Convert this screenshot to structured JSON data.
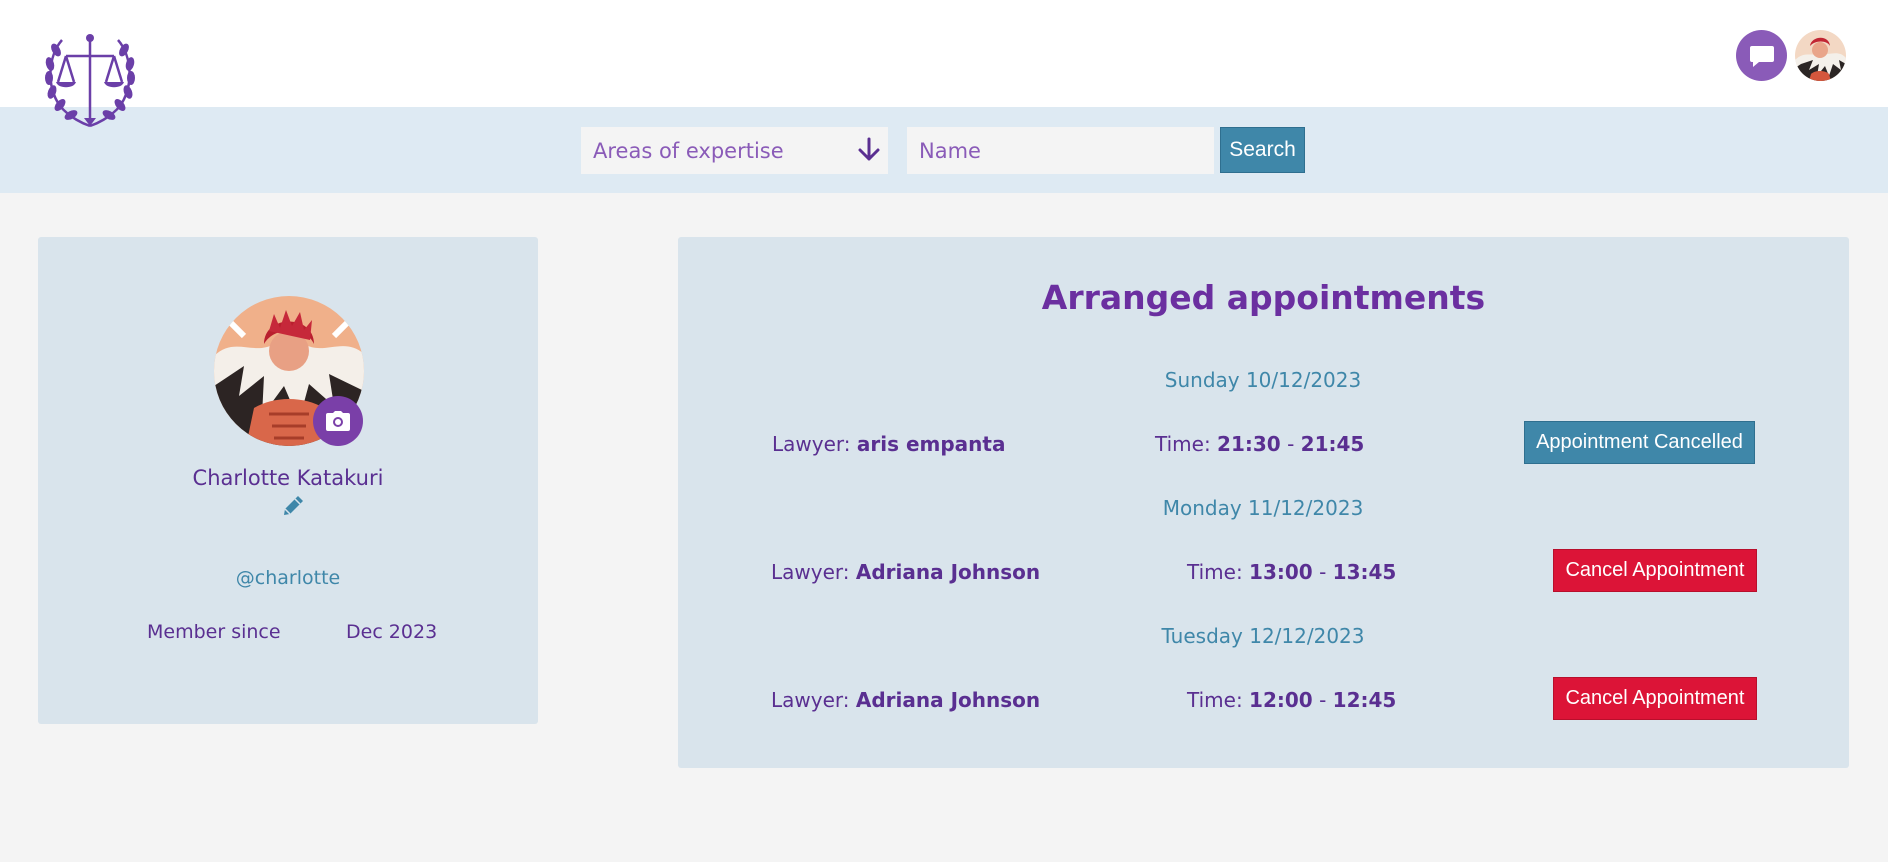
{
  "header": {
    "logo_icon": "scales-of-justice-laurel-logo",
    "chat_icon": "chat-bubble-icon",
    "avatar_icon": "user-avatar"
  },
  "search": {
    "expertise_label": "Areas of expertise",
    "name_placeholder": "Name",
    "search_label": "Search"
  },
  "profile": {
    "name": "Charlotte Katakuri",
    "handle": "@charlotte",
    "member_since_label": "Member since",
    "member_since_value": "Dec 2023"
  },
  "appointments": {
    "title": "Arranged appointments",
    "items": [
      {
        "day": "Sunday 10/12/2023",
        "lawyer_label": "Lawyer:",
        "lawyer_name": "aris empanta",
        "time_label": "Time:",
        "start": "21:30",
        "sep": "-",
        "end": "21:45",
        "action": "Appointment Cancelled",
        "status": "cancelled"
      },
      {
        "day": "Monday 11/12/2023",
        "lawyer_label": "Lawyer:",
        "lawyer_name": "Adriana Johnson",
        "time_label": "Time:",
        "start": "13:00",
        "sep": "-",
        "end": "13:45",
        "action": "Cancel Appointment",
        "status": "active"
      },
      {
        "day": "Tuesday 12/12/2023",
        "lawyer_label": "Lawyer:",
        "lawyer_name": "Adriana Johnson",
        "time_label": "Time:",
        "start": "12:00",
        "sep": "-",
        "end": "12:45",
        "action": "Cancel Appointment",
        "status": "active"
      }
    ]
  },
  "colors": {
    "brand_purple": "#6b2fa0",
    "accent_blue": "#3f87a9",
    "danger_red": "#dc1437"
  }
}
